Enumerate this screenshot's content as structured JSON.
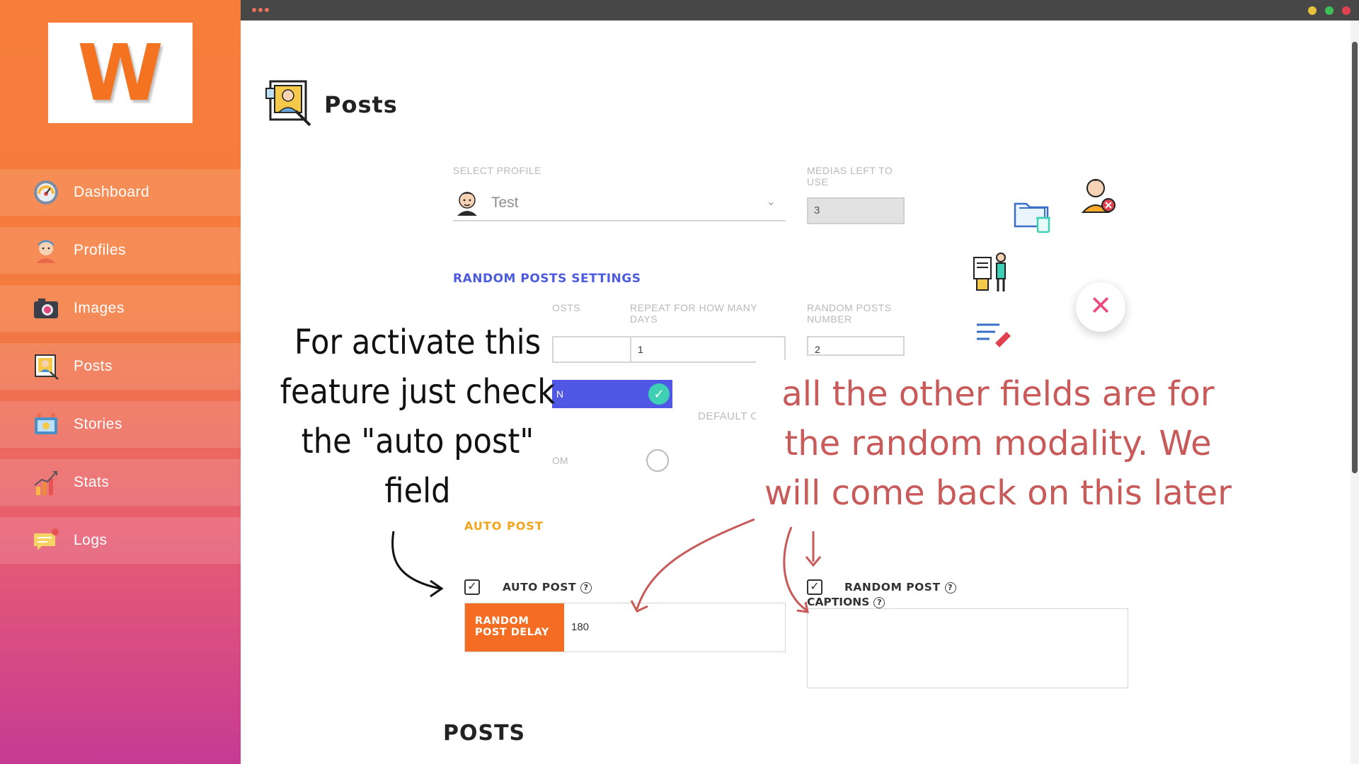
{
  "logo": {
    "letter": "W"
  },
  "sidebar": {
    "items": [
      {
        "label": "Dashboard",
        "icon": "dashboard-gauge-icon"
      },
      {
        "label": "Profiles",
        "icon": "user-avatar-icon"
      },
      {
        "label": "Images",
        "icon": "camera-icon"
      },
      {
        "label": "Posts",
        "icon": "posts-portrait-icon"
      },
      {
        "label": "Stories",
        "icon": "stories-icon"
      },
      {
        "label": "Stats",
        "icon": "bar-chart-icon"
      },
      {
        "label": "Logs",
        "icon": "chat-notification-icon"
      }
    ]
  },
  "page": {
    "title": "Posts"
  },
  "form": {
    "select_profile_label": "SELECT PROFILE",
    "profile_value": "Test",
    "medias_left_label": "MEDIAS LEFT TO USE",
    "medias_left_value": "3",
    "section_title": "RANDOM POSTS SETTINGS",
    "col1_label_partial": "OSTS",
    "repeat_label": "REPEAT FOR HOW MANY DAYS",
    "repeat_value": "1",
    "random_number_label": "RANDOM POSTS NUMBER",
    "random_number_value": "2",
    "toggle_partial_label": "N",
    "default_partial_label": "DEFAULT C",
    "radio_partial_label": "OM",
    "auto_post_section": "AUTO POST",
    "auto_post_label": "AUTO POST",
    "random_post_label": "RANDOM POST",
    "delay_label": "RANDOM POST DELAY",
    "delay_value": "180",
    "captions_label": "CAPTIONS",
    "help_glyph": "?"
  },
  "posts_heading": "POSTS",
  "close_glyph": "✕",
  "annotations": {
    "left_note": "For activate this feature just check the \"auto post\" field",
    "right_note": "all the other fields are for the random modality. We will come back on this later"
  },
  "colors": {
    "accent_orange": "#f46d22",
    "accent_blue": "#4d5be0",
    "toggle_blue": "#5057e5",
    "check_teal": "#3fcfb4",
    "close_pink": "#ea4d7c",
    "auto_post_yellow": "#f2a51a",
    "annotation_red": "#c85a5a"
  }
}
